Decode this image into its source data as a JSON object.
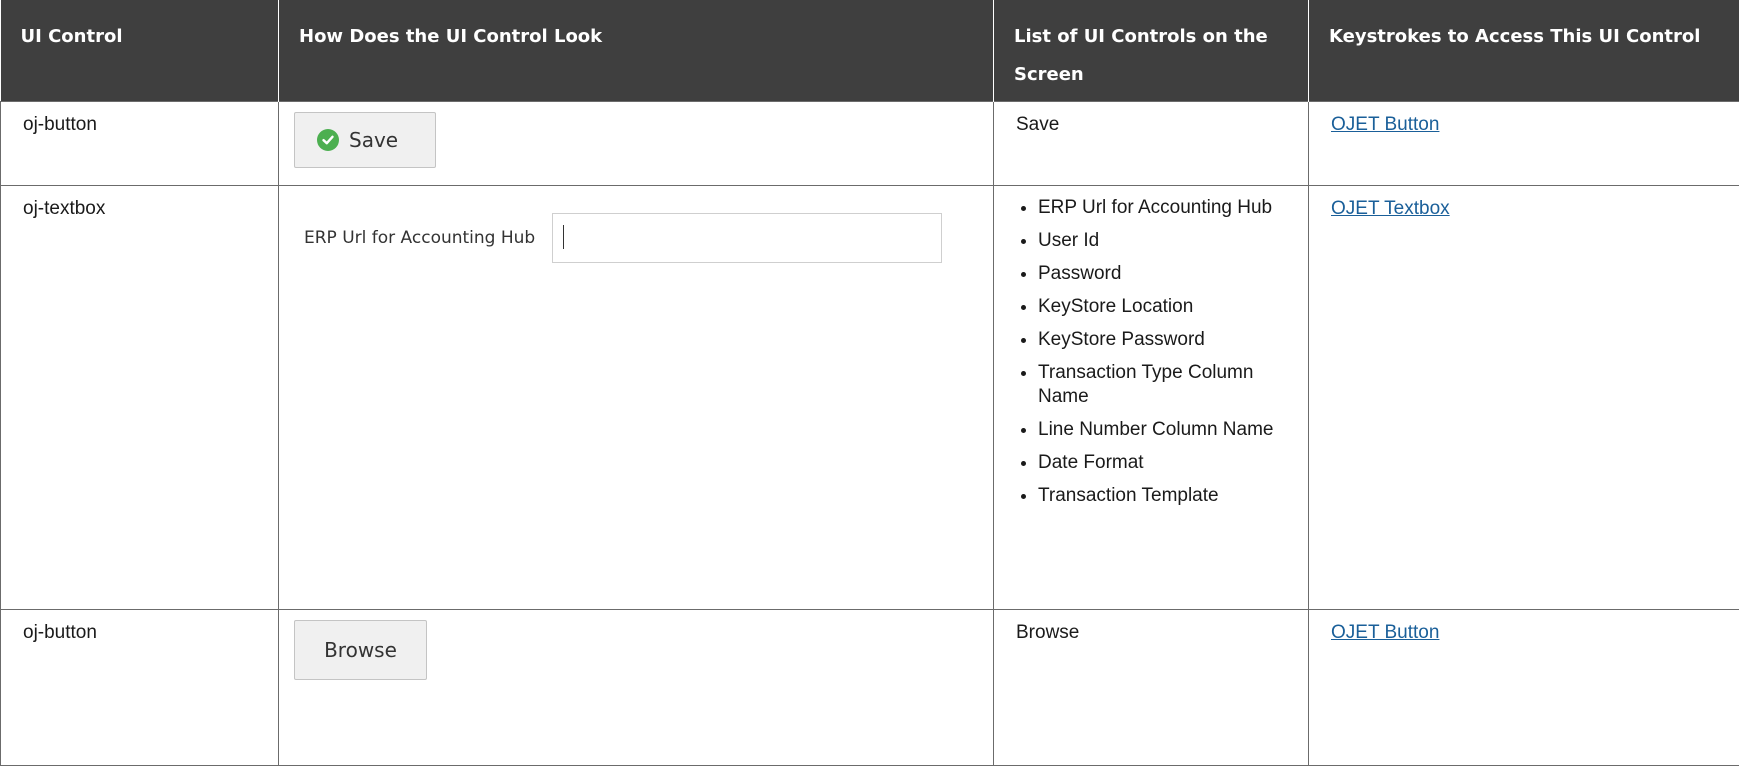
{
  "headers": [
    "UI Control",
    "How Does the UI Control Look",
    "List of UI Controls on the Screen",
    "Keystrokes to Access This UI Control"
  ],
  "rows": [
    {
      "control": "oj-button",
      "look": {
        "button_label": "Save",
        "icon": "check-circle-icon"
      },
      "list_text": "Save",
      "keystroke_link": "OJET Button"
    },
    {
      "control": "oj-textbox",
      "look": {
        "field_label": "ERP Url for Accounting Hub",
        "field_value": ""
      },
      "list_items": [
        "ERP Url for Accounting Hub",
        "User Id",
        "Password",
        "KeyStore Location",
        "KeyStore Password",
        "Transaction Type Column Name",
        "Line Number Column Name",
        "Date Format",
        "Transaction Template"
      ],
      "keystroke_link": "OJET Textbox"
    },
    {
      "control": "oj-button",
      "look": {
        "button_label": "Browse"
      },
      "list_text": "Browse",
      "keystroke_link": "OJET Button"
    }
  ],
  "colors": {
    "header_bg": "#3f3f3f",
    "link": "#1a5f99",
    "check": "#4caf50"
  }
}
